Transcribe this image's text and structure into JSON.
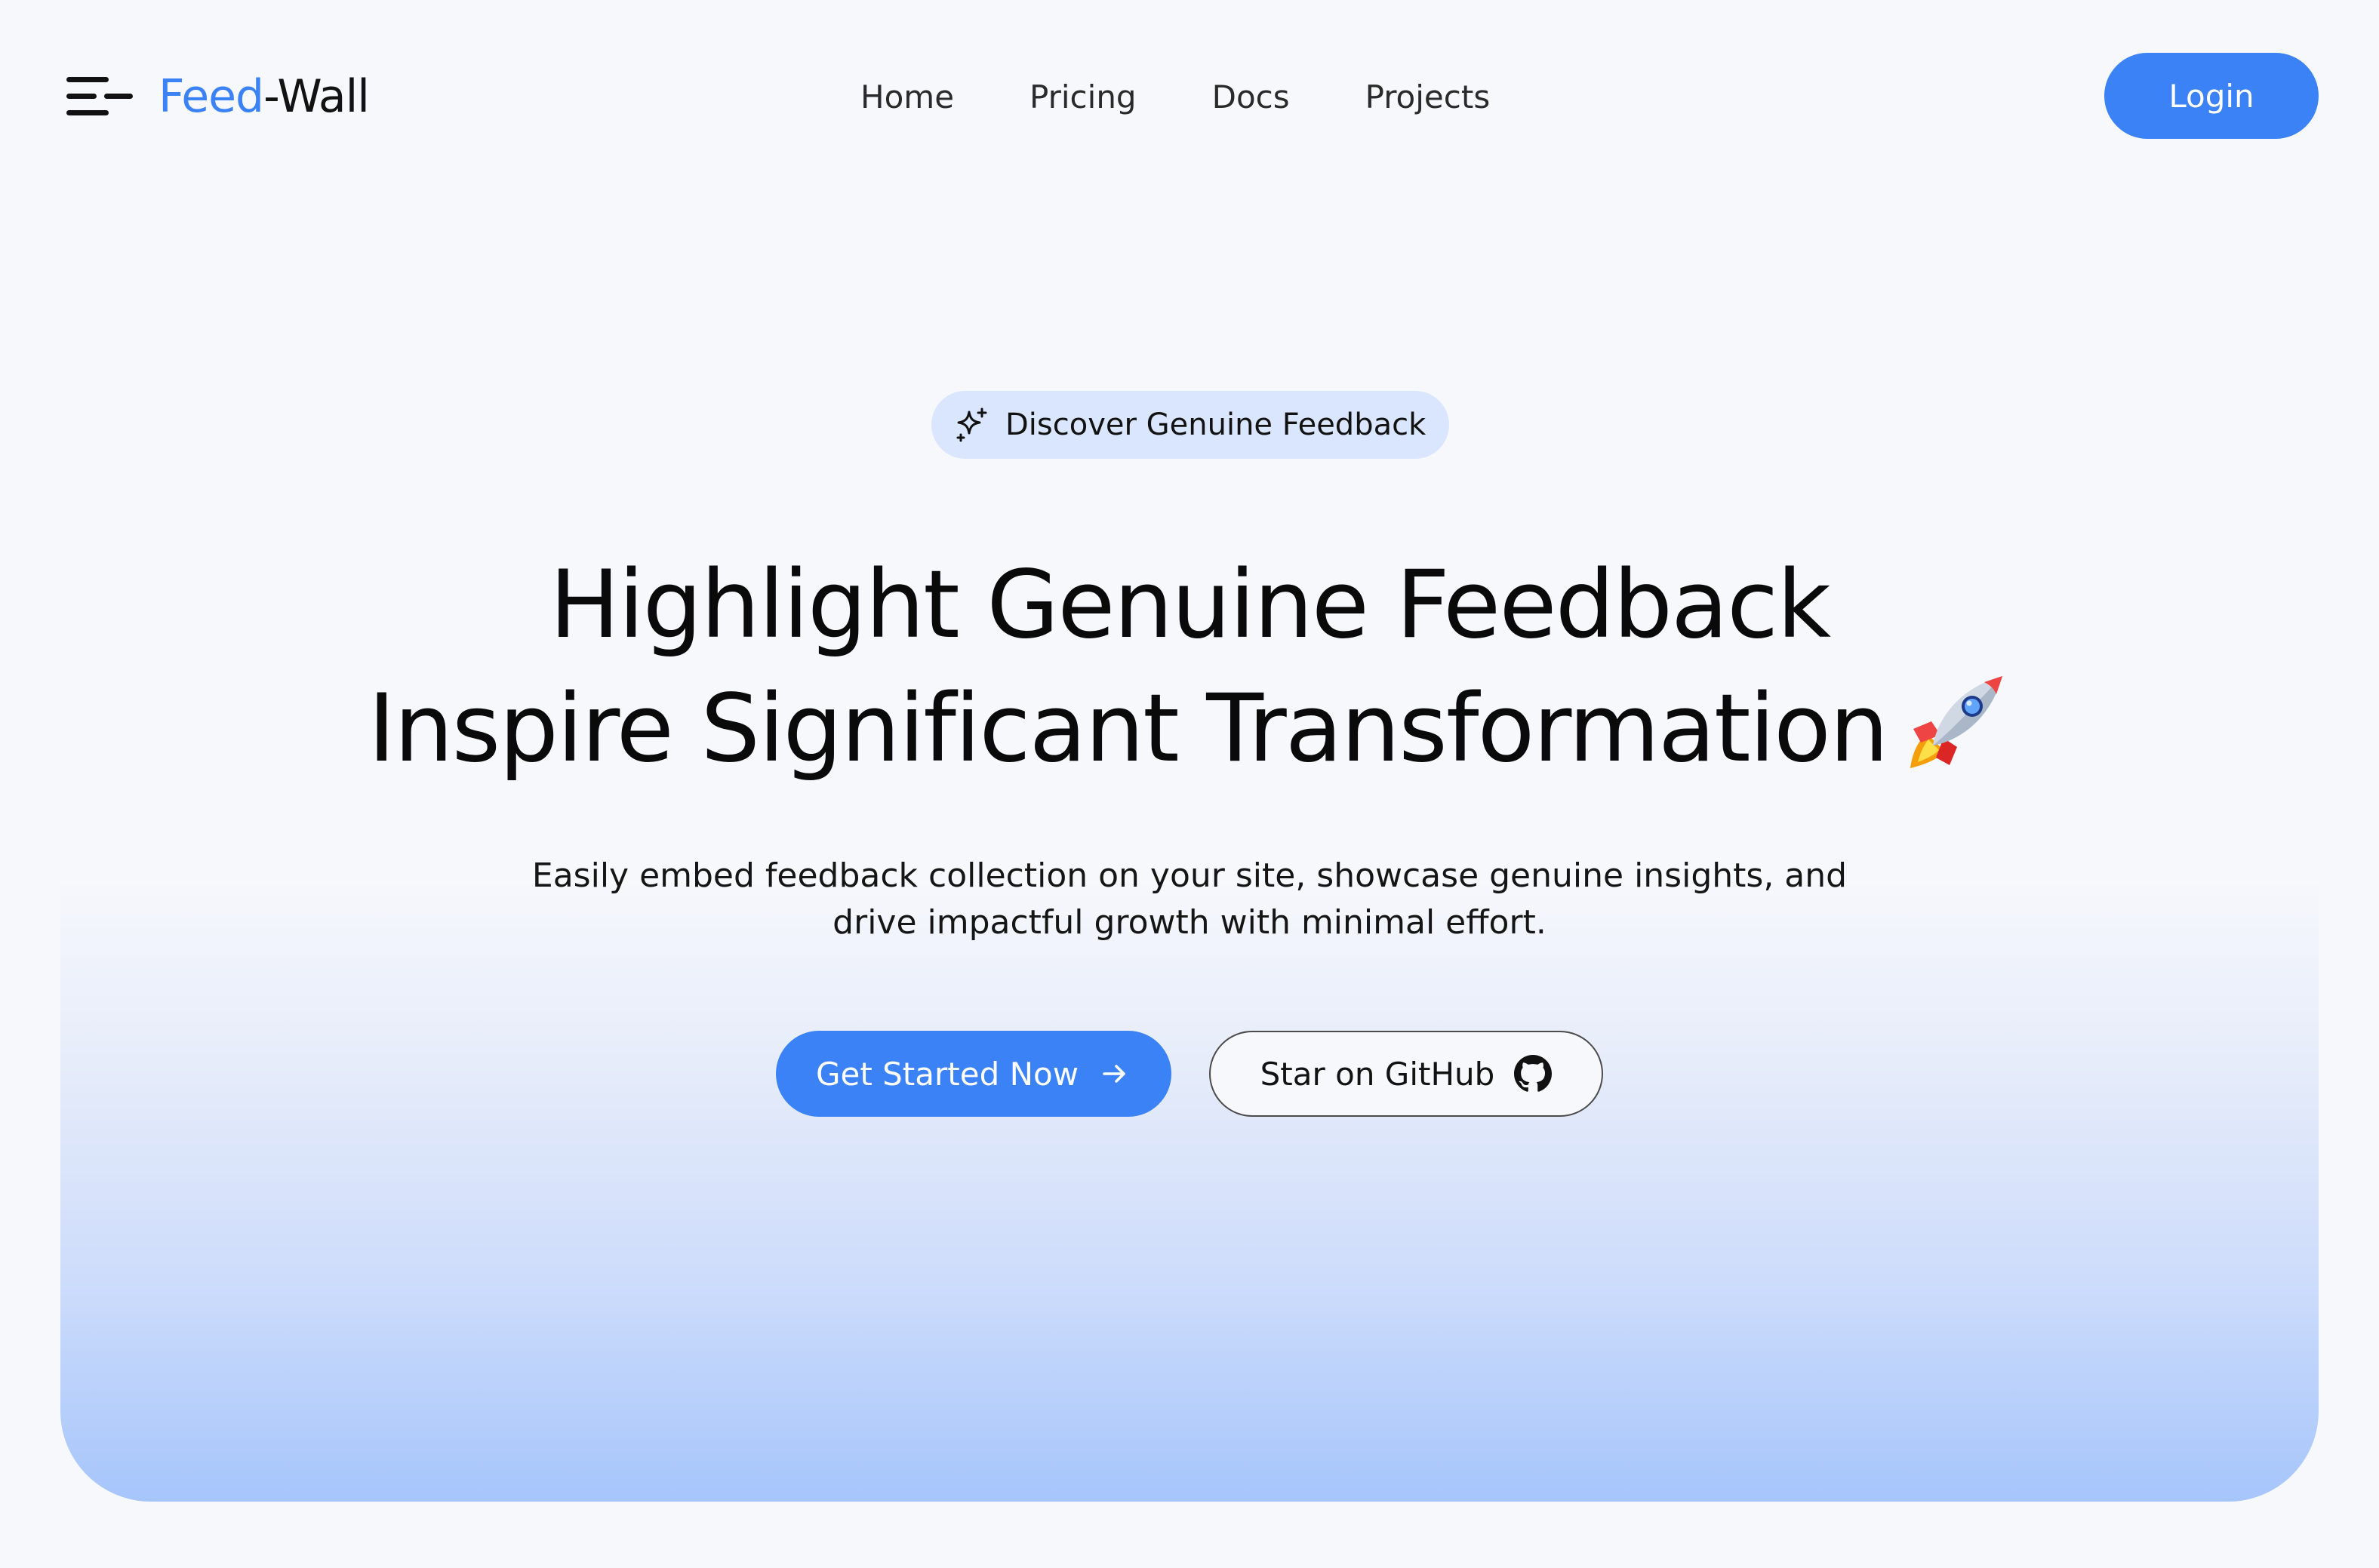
{
  "brand": {
    "name_accent": "Feed",
    "name_rest": "-Wall",
    "menu_icon": "hamburger-menu-icon",
    "accent_color": "#3b82f6"
  },
  "nav": {
    "items": [
      "Home",
      "Pricing",
      "Docs",
      "Projects"
    ]
  },
  "header": {
    "login_label": "Login"
  },
  "hero": {
    "badge_icon": "sparkles-icon",
    "badge_text": "Discover Genuine Feedback",
    "headline_line1": "Highlight Genuine Feedback",
    "headline_line2": "Inspire Significant Transformation",
    "headline_icon": "rocket-icon",
    "subtitle_line1": "Easily embed feedback collection on your site, showcase genuine insights, and",
    "subtitle_line2": "drive impactful growth with minimal effort.",
    "primary_cta": "Get Started Now",
    "primary_cta_icon": "arrow-right-icon",
    "secondary_cta": "Star on GitHub",
    "secondary_cta_icon": "github-icon",
    "gradient_color": "#a6c5fb"
  }
}
